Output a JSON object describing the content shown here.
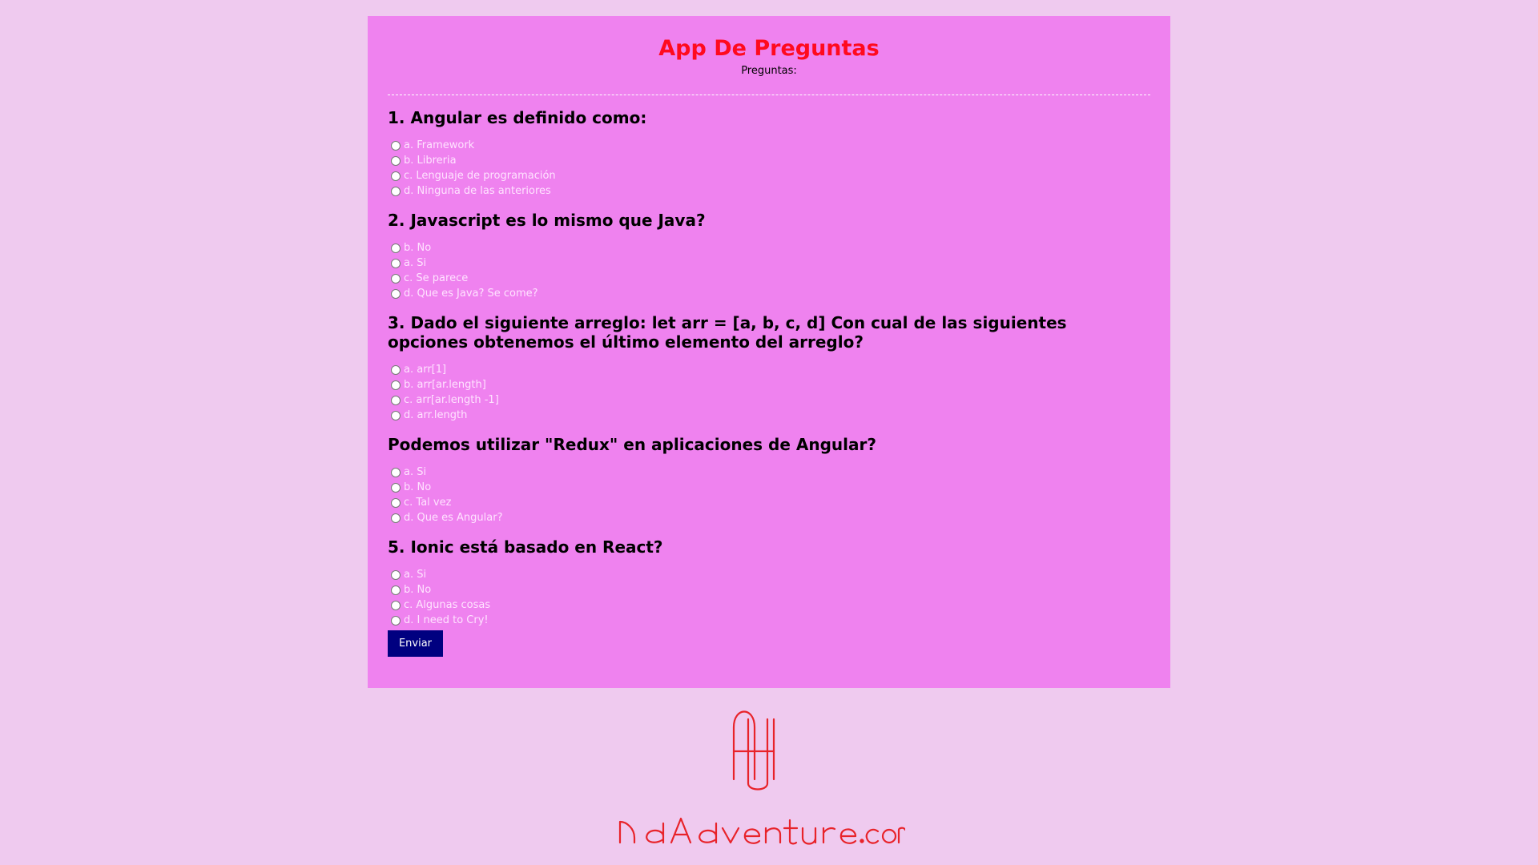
{
  "app": {
    "title": "App De Preguntas",
    "subtitle": "Preguntas:"
  },
  "questions": [
    {
      "title": "1. Angular es definido como:",
      "options": [
        "a. Framework",
        "b. Libreria",
        "c. Lenguaje de programación",
        "d. Ninguna de las anteriores"
      ]
    },
    {
      "title": "2. Javascript es lo mismo que Java?",
      "options": [
        "b. No",
        "a. Si",
        "c. Se parece",
        "d. Que es Java? Se come?"
      ]
    },
    {
      "title": "3. Dado el siguiente arreglo: let arr = [a, b, c, d] Con cual de las siguientes opciones obtenemos el último elemento del arreglo?",
      "options": [
        "a. arr[1]",
        "b. arr[ar.length]",
        "c. arr[ar.length -1]",
        "d. arr.length"
      ]
    },
    {
      "title": "Podemos utilizar \"Redux\" en aplicaciones de Angular?",
      "options": [
        "a. Si",
        "b. No",
        "c. Tal vez",
        "d. Que es Angular?"
      ]
    },
    {
      "title": "5. Ionic está basado en React?",
      "options": [
        "a. Si",
        "b. No",
        "c. Algunas cosas",
        "d. I need to Cry!"
      ]
    }
  ],
  "submit_label": "Enviar",
  "footer": {
    "logo_text": "NdAdventure.com",
    "logo_color": "#e8232a"
  },
  "colors": {
    "background": "#efcaef",
    "panel": "#ef82ef",
    "title": "#ff0a1e",
    "button": "#000080",
    "option_text": "#ffe3ff"
  }
}
